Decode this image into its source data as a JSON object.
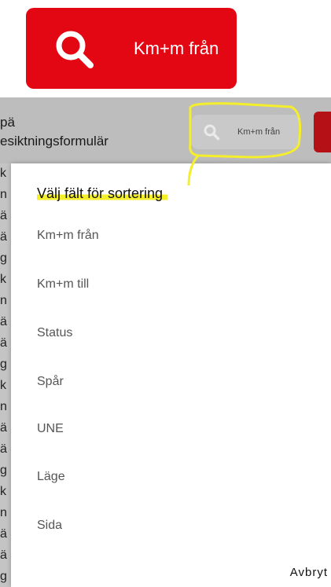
{
  "zoom_button": {
    "label": "Km+m från",
    "icon": "search-icon",
    "color": "#e30613"
  },
  "screen": {
    "header": {
      "line1": "pä",
      "line2": "esiktningsformulär"
    },
    "search": {
      "label": "Km+m från",
      "icon": "search-icon"
    },
    "left_chars": [
      "k",
      "n",
      "ä",
      "ä",
      "g",
      "k",
      "n",
      "ä",
      "ä",
      "g",
      "k",
      "n",
      "ä",
      "ä",
      "g",
      "k",
      "n",
      "ä",
      "ä",
      "g"
    ],
    "dialog": {
      "title": "Välj fält för sortering",
      "options": [
        "Km+m från",
        "Km+m till",
        "Status",
        "Spår",
        "UNE",
        "Läge",
        "Sida"
      ],
      "cancel": "Avbryt"
    },
    "highlight_color": "#f5ee2a"
  }
}
